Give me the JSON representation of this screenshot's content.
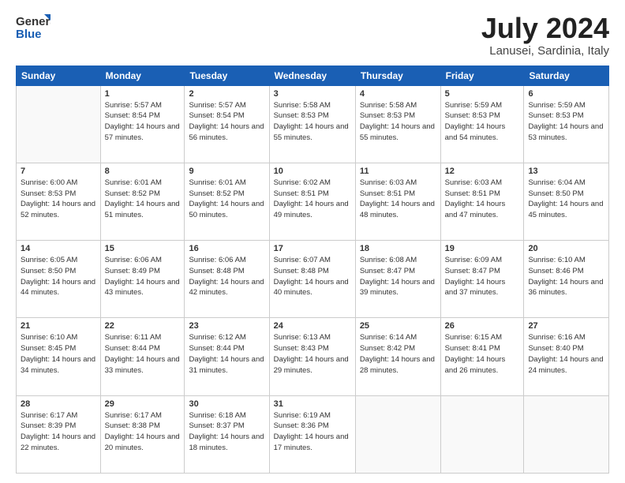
{
  "header": {
    "logo_general": "General",
    "logo_blue": "Blue",
    "title": "July 2024",
    "subtitle": "Lanusei, Sardinia, Italy"
  },
  "weekdays": [
    "Sunday",
    "Monday",
    "Tuesday",
    "Wednesday",
    "Thursday",
    "Friday",
    "Saturday"
  ],
  "weeks": [
    [
      {
        "day": "",
        "sunrise": "",
        "sunset": "",
        "daylight": ""
      },
      {
        "day": "1",
        "sunrise": "Sunrise: 5:57 AM",
        "sunset": "Sunset: 8:54 PM",
        "daylight": "Daylight: 14 hours and 57 minutes."
      },
      {
        "day": "2",
        "sunrise": "Sunrise: 5:57 AM",
        "sunset": "Sunset: 8:54 PM",
        "daylight": "Daylight: 14 hours and 56 minutes."
      },
      {
        "day": "3",
        "sunrise": "Sunrise: 5:58 AM",
        "sunset": "Sunset: 8:53 PM",
        "daylight": "Daylight: 14 hours and 55 minutes."
      },
      {
        "day": "4",
        "sunrise": "Sunrise: 5:58 AM",
        "sunset": "Sunset: 8:53 PM",
        "daylight": "Daylight: 14 hours and 55 minutes."
      },
      {
        "day": "5",
        "sunrise": "Sunrise: 5:59 AM",
        "sunset": "Sunset: 8:53 PM",
        "daylight": "Daylight: 14 hours and 54 minutes."
      },
      {
        "day": "6",
        "sunrise": "Sunrise: 5:59 AM",
        "sunset": "Sunset: 8:53 PM",
        "daylight": "Daylight: 14 hours and 53 minutes."
      }
    ],
    [
      {
        "day": "7",
        "sunrise": "Sunrise: 6:00 AM",
        "sunset": "Sunset: 8:53 PM",
        "daylight": "Daylight: 14 hours and 52 minutes."
      },
      {
        "day": "8",
        "sunrise": "Sunrise: 6:01 AM",
        "sunset": "Sunset: 8:52 PM",
        "daylight": "Daylight: 14 hours and 51 minutes."
      },
      {
        "day": "9",
        "sunrise": "Sunrise: 6:01 AM",
        "sunset": "Sunset: 8:52 PM",
        "daylight": "Daylight: 14 hours and 50 minutes."
      },
      {
        "day": "10",
        "sunrise": "Sunrise: 6:02 AM",
        "sunset": "Sunset: 8:51 PM",
        "daylight": "Daylight: 14 hours and 49 minutes."
      },
      {
        "day": "11",
        "sunrise": "Sunrise: 6:03 AM",
        "sunset": "Sunset: 8:51 PM",
        "daylight": "Daylight: 14 hours and 48 minutes."
      },
      {
        "day": "12",
        "sunrise": "Sunrise: 6:03 AM",
        "sunset": "Sunset: 8:51 PM",
        "daylight": "Daylight: 14 hours and 47 minutes."
      },
      {
        "day": "13",
        "sunrise": "Sunrise: 6:04 AM",
        "sunset": "Sunset: 8:50 PM",
        "daylight": "Daylight: 14 hours and 45 minutes."
      }
    ],
    [
      {
        "day": "14",
        "sunrise": "Sunrise: 6:05 AM",
        "sunset": "Sunset: 8:50 PM",
        "daylight": "Daylight: 14 hours and 44 minutes."
      },
      {
        "day": "15",
        "sunrise": "Sunrise: 6:06 AM",
        "sunset": "Sunset: 8:49 PM",
        "daylight": "Daylight: 14 hours and 43 minutes."
      },
      {
        "day": "16",
        "sunrise": "Sunrise: 6:06 AM",
        "sunset": "Sunset: 8:48 PM",
        "daylight": "Daylight: 14 hours and 42 minutes."
      },
      {
        "day": "17",
        "sunrise": "Sunrise: 6:07 AM",
        "sunset": "Sunset: 8:48 PM",
        "daylight": "Daylight: 14 hours and 40 minutes."
      },
      {
        "day": "18",
        "sunrise": "Sunrise: 6:08 AM",
        "sunset": "Sunset: 8:47 PM",
        "daylight": "Daylight: 14 hours and 39 minutes."
      },
      {
        "day": "19",
        "sunrise": "Sunrise: 6:09 AM",
        "sunset": "Sunset: 8:47 PM",
        "daylight": "Daylight: 14 hours and 37 minutes."
      },
      {
        "day": "20",
        "sunrise": "Sunrise: 6:10 AM",
        "sunset": "Sunset: 8:46 PM",
        "daylight": "Daylight: 14 hours and 36 minutes."
      }
    ],
    [
      {
        "day": "21",
        "sunrise": "Sunrise: 6:10 AM",
        "sunset": "Sunset: 8:45 PM",
        "daylight": "Daylight: 14 hours and 34 minutes."
      },
      {
        "day": "22",
        "sunrise": "Sunrise: 6:11 AM",
        "sunset": "Sunset: 8:44 PM",
        "daylight": "Daylight: 14 hours and 33 minutes."
      },
      {
        "day": "23",
        "sunrise": "Sunrise: 6:12 AM",
        "sunset": "Sunset: 8:44 PM",
        "daylight": "Daylight: 14 hours and 31 minutes."
      },
      {
        "day": "24",
        "sunrise": "Sunrise: 6:13 AM",
        "sunset": "Sunset: 8:43 PM",
        "daylight": "Daylight: 14 hours and 29 minutes."
      },
      {
        "day": "25",
        "sunrise": "Sunrise: 6:14 AM",
        "sunset": "Sunset: 8:42 PM",
        "daylight": "Daylight: 14 hours and 28 minutes."
      },
      {
        "day": "26",
        "sunrise": "Sunrise: 6:15 AM",
        "sunset": "Sunset: 8:41 PM",
        "daylight": "Daylight: 14 hours and 26 minutes."
      },
      {
        "day": "27",
        "sunrise": "Sunrise: 6:16 AM",
        "sunset": "Sunset: 8:40 PM",
        "daylight": "Daylight: 14 hours and 24 minutes."
      }
    ],
    [
      {
        "day": "28",
        "sunrise": "Sunrise: 6:17 AM",
        "sunset": "Sunset: 8:39 PM",
        "daylight": "Daylight: 14 hours and 22 minutes."
      },
      {
        "day": "29",
        "sunrise": "Sunrise: 6:17 AM",
        "sunset": "Sunset: 8:38 PM",
        "daylight": "Daylight: 14 hours and 20 minutes."
      },
      {
        "day": "30",
        "sunrise": "Sunrise: 6:18 AM",
        "sunset": "Sunset: 8:37 PM",
        "daylight": "Daylight: 14 hours and 18 minutes."
      },
      {
        "day": "31",
        "sunrise": "Sunrise: 6:19 AM",
        "sunset": "Sunset: 8:36 PM",
        "daylight": "Daylight: 14 hours and 17 minutes."
      },
      {
        "day": "",
        "sunrise": "",
        "sunset": "",
        "daylight": ""
      },
      {
        "day": "",
        "sunrise": "",
        "sunset": "",
        "daylight": ""
      },
      {
        "day": "",
        "sunrise": "",
        "sunset": "",
        "daylight": ""
      }
    ]
  ]
}
